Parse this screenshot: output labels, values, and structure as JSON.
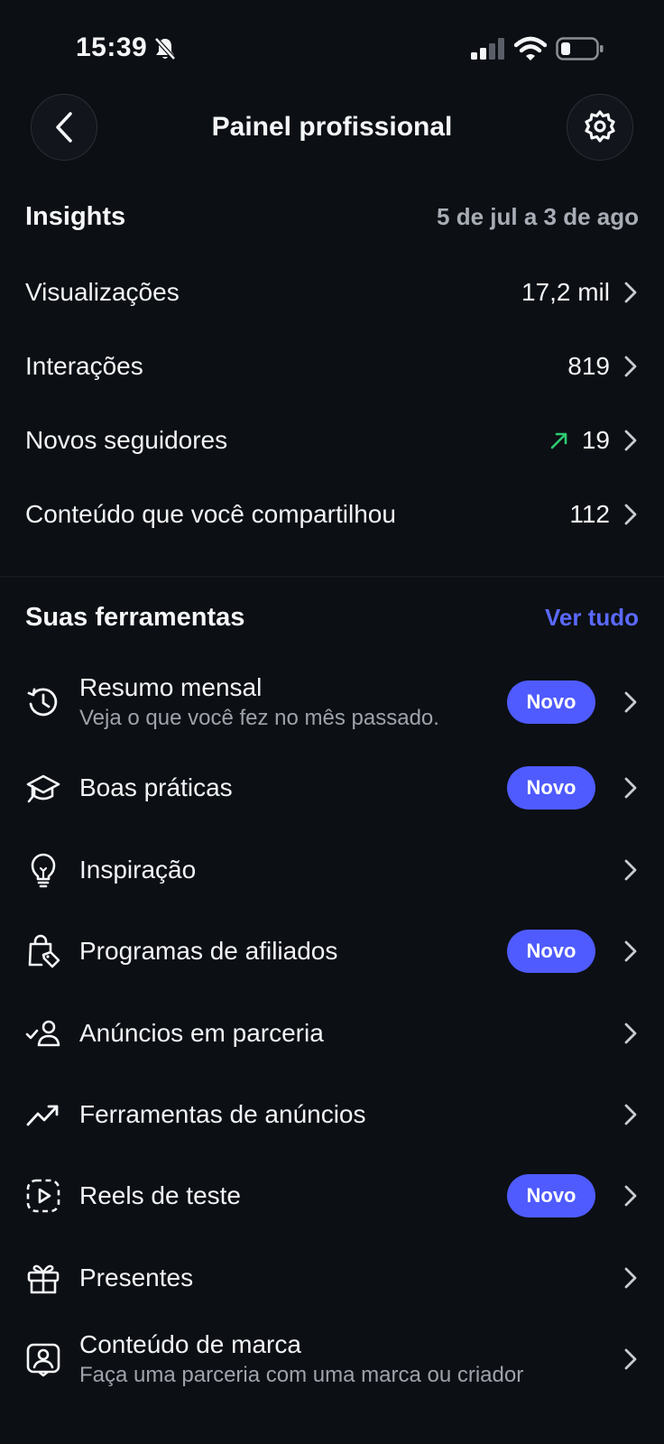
{
  "status": {
    "time": "15:39"
  },
  "header": {
    "title": "Painel profissional"
  },
  "insights": {
    "title": "Insights",
    "date_range": "5 de jul a 3 de ago",
    "metrics": [
      {
        "label": "Visualizações",
        "value": "17,2 mil"
      },
      {
        "label": "Interações",
        "value": "819"
      },
      {
        "label": "Novos seguidores",
        "value": "19",
        "trend": "up"
      },
      {
        "label": "Conteúdo que você compartilhou",
        "value": "112"
      }
    ]
  },
  "tools": {
    "title": "Suas ferramentas",
    "see_all": "Ver tudo",
    "badge_label": "Novo",
    "items": [
      {
        "label": "Resumo mensal",
        "subtitle": "Veja o que você fez no mês passado.",
        "icon": "history-icon",
        "badge": true
      },
      {
        "label": "Boas práticas",
        "icon": "graduation-cap-icon",
        "badge": true
      },
      {
        "label": "Inspiração",
        "icon": "lightbulb-icon",
        "badge": false
      },
      {
        "label": "Programas de afiliados",
        "icon": "shopping-bag-tag-icon",
        "badge": true
      },
      {
        "label": "Anúncios em parceria",
        "icon": "user-check-icon",
        "badge": false
      },
      {
        "label": "Ferramentas de anúncios",
        "icon": "trending-up-icon",
        "badge": false
      },
      {
        "label": "Reels de teste",
        "icon": "reels-test-icon",
        "badge": true
      },
      {
        "label": "Presentes",
        "icon": "gift-icon",
        "badge": false
      },
      {
        "label": "Conteúdo de marca",
        "subtitle": "Faça uma parceria com uma marca ou criador",
        "icon": "branded-content-icon",
        "badge": false
      }
    ]
  },
  "colors": {
    "accent": "#4f5bff",
    "link": "#5b69ff",
    "trend_up": "#2ecc71",
    "background": "#0c0f14"
  }
}
